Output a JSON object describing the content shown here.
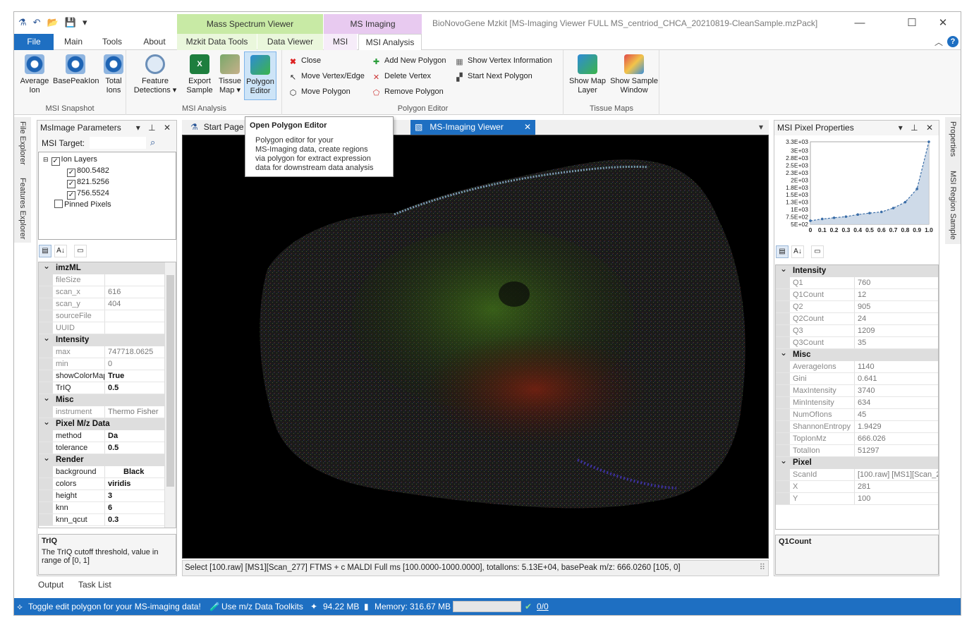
{
  "window": {
    "title": "BioNovoGene Mzkit [MS-Imaging Viewer FULL MS_centriod_CHCA_20210819-CleanSample.mzPack]",
    "context_tabs": {
      "mass_spectrum": "Mass Spectrum Viewer",
      "ms_imaging": "MS Imaging"
    },
    "min": "—",
    "max": "☐",
    "close": "✕"
  },
  "tabs": {
    "file": "File",
    "main": "Main",
    "tools": "Tools",
    "about": "About",
    "mzkit_data_tools": "Mzkit Data Tools",
    "data_viewer": "Data Viewer",
    "msi": "MSI",
    "msi_analysis": "MSI Analysis"
  },
  "ribbon": {
    "msi_snapshot": {
      "label": "MSI Snapshot",
      "average_ion": "Average\nIon",
      "base_peak_ion": "BasePeakIon",
      "total_ions": "Total\nIons"
    },
    "msi_analysis": {
      "label": "MSI Analysis",
      "feature_detections": "Feature\nDetections ▾",
      "export_sample": "Export\nSample",
      "tissue_map": "Tissue\nMap ▾",
      "polygon_editor": "Polygon\nEditor"
    },
    "polygon_editor": {
      "label": "Polygon Editor",
      "close": "Close",
      "move_vertex_edge": "Move Vertex/Edge",
      "move_polygon": "Move Polygon",
      "add_new_polygon": "Add New Polygon",
      "delete_vertex": "Delete Vertex",
      "remove_polygon": "Remove Polygon",
      "show_vertex_information": "Show Vertex Information",
      "start_next_polygon": "Start Next Polygon"
    },
    "tissue_maps": {
      "label": "Tissue Maps",
      "show_map_layer": "Show Map\nLayer",
      "show_sample_window": "Show Sample\nWindow"
    }
  },
  "tooltip": {
    "title": "Open Polygon Editor",
    "body": [
      "Polygon editor for your",
      "MS-Imaging data, create regions",
      "via polygon for extract expression",
      "data for downstream data analysis"
    ]
  },
  "left_side_tabs": [
    "File Explorer",
    "Features Explorer"
  ],
  "right_side_tabs": [
    "Properties",
    "MSI Region Sample"
  ],
  "msimage_params": {
    "title": "MsImage Parameters",
    "msi_target_label": "MSI Target:",
    "tree": {
      "ion_layers": "Ion Layers",
      "layers": [
        "800.5482",
        "821.5256",
        "756.5524"
      ],
      "pinned": "Pinned Pixels"
    },
    "categories": {
      "imzml": "imzML",
      "intensity": "Intensity",
      "misc": "Misc",
      "pixel_mz": "Pixel M/z Data",
      "render": "Render"
    },
    "imzml_rows": [
      [
        "fileSize",
        ""
      ],
      [
        "scan_x",
        "616"
      ],
      [
        "scan_y",
        "404"
      ],
      [
        "sourceFile",
        ""
      ],
      [
        "UUID",
        ""
      ]
    ],
    "intensity_rows": [
      [
        "max",
        "747718.0625"
      ],
      [
        "min",
        "0"
      ]
    ],
    "intensity_rows_bold": [
      [
        "showColorMap",
        "True"
      ],
      [
        "TrIQ",
        "0.5"
      ]
    ],
    "misc_rows": [
      [
        "instrument",
        "Thermo Fisher"
      ]
    ],
    "pixel_rows": [
      [
        "method",
        "Da"
      ],
      [
        "tolerance",
        "0.5"
      ]
    ],
    "render_rows": [
      [
        "background",
        "Black"
      ],
      [
        "colors",
        "viridis"
      ],
      [
        "height",
        "3"
      ],
      [
        "knn",
        "6"
      ],
      [
        "knn_qcut",
        "0.3"
      ]
    ],
    "desc_title": "TrIQ",
    "desc_text": "The TrIQ cutoff threshold, value in range of [0, 1]"
  },
  "doc_tabs": {
    "start_page": "Start Page",
    "msi_viewer": "MS-Imaging Viewer",
    "close": "✕"
  },
  "viewer_status": "Select [100.raw] [MS1][Scan_277] FTMS + c MALDI Full ms [100.0000-1000.0000], totalIons: 5.13E+04, basePeak m/z: 666.0260   [105, 0]",
  "pixel_props": {
    "title": "MSI Pixel Properties",
    "categories": {
      "intensity": "Intensity",
      "misc": "Misc",
      "pixel": "Pixel"
    },
    "intensity_rows": [
      [
        "Q1",
        "760"
      ],
      [
        "Q1Count",
        "12"
      ],
      [
        "Q2",
        "905"
      ],
      [
        "Q2Count",
        "24"
      ],
      [
        "Q3",
        "1209"
      ],
      [
        "Q3Count",
        "35"
      ]
    ],
    "misc_rows": [
      [
        "AverageIons",
        "1140"
      ],
      [
        "Gini",
        "0.641"
      ],
      [
        "MaxIntensity",
        "3740"
      ],
      [
        "MinIntensity",
        "634"
      ],
      [
        "NumOfIons",
        "45"
      ],
      [
        "ShannonEntropy",
        "1.9429"
      ],
      [
        "TopIonMz",
        "666.026"
      ],
      [
        "TotalIon",
        "51297"
      ]
    ],
    "pixel_rows": [
      [
        "ScanId",
        "[100.raw] [MS1][Scan_2"
      ],
      [
        "X",
        "281"
      ],
      [
        "Y",
        "100"
      ]
    ],
    "desc_title": "Q1Count"
  },
  "chart_data": {
    "type": "area",
    "x": [
      0,
      0.1,
      0.2,
      0.3,
      0.4,
      0.5,
      0.6,
      0.7,
      0.8,
      0.9,
      1.0
    ],
    "values": [
      620,
      680,
      720,
      760,
      830,
      880,
      920,
      1050,
      1250,
      1700,
      3300
    ],
    "xlim": [
      0,
      1
    ],
    "ylim": [
      500,
      3300
    ],
    "x_ticks": [
      "0",
      "0.1",
      "0.2",
      "0.3",
      "0.4",
      "0.5",
      "0.6",
      "0.7",
      "0.8",
      "0.9",
      "1.0"
    ],
    "y_ticks": [
      "3.3E+03",
      "3E+03",
      "2.8E+03",
      "2.5E+03",
      "2.3E+03",
      "2E+03",
      "1.8E+03",
      "1.5E+03",
      "1.3E+03",
      "1E+03",
      "7.5E+02",
      "5E+02"
    ],
    "line_color": "#3b6ea8",
    "fill_color": "#c9d6e6"
  },
  "bottom_tabs": {
    "output": "Output",
    "task_list": "Task List"
  },
  "statusbar": {
    "message": "Toggle edit polygon for your MS-imaging data!",
    "toolkit": "Use m/z Data Toolkits",
    "mem1": "94.22 MB",
    "mem2": "Memory: 316.67 MB",
    "tasks": "0/0"
  },
  "colors": {
    "accent": "#1e6fc2",
    "ctx_green": "#c8eaa5",
    "ctx_purple": "#e8caf0"
  }
}
